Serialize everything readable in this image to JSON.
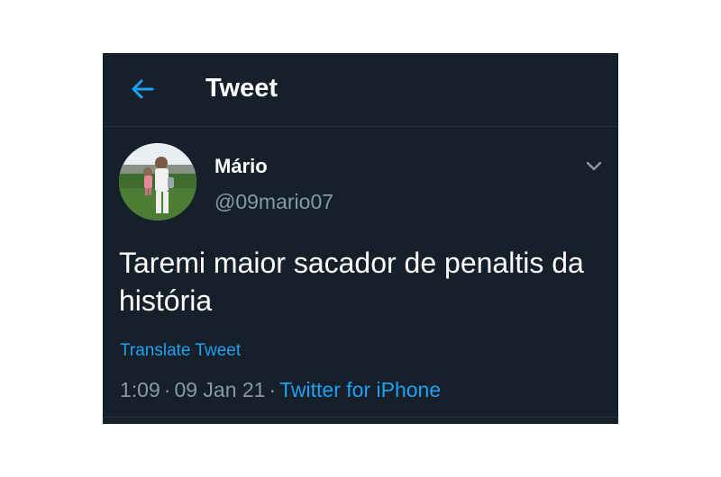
{
  "header": {
    "title": "Tweet",
    "back_icon": "arrow-left-icon"
  },
  "tweet": {
    "author": {
      "display_name": "Mário",
      "handle": "@09mario07",
      "avatar_description": "avatar-photo"
    },
    "menu_icon": "chevron-down-icon",
    "text": "Taremi maior sacador de penaltis da história",
    "translate_label": "Translate Tweet",
    "time": "1:09",
    "date": "09 Jan 21",
    "separator": "·",
    "source": "Twitter for iPhone"
  },
  "colors": {
    "background": "#15202b",
    "text_primary": "#ffffff",
    "text_secondary": "#8899a6",
    "accent": "#1da1f2",
    "divider": "#253341"
  }
}
